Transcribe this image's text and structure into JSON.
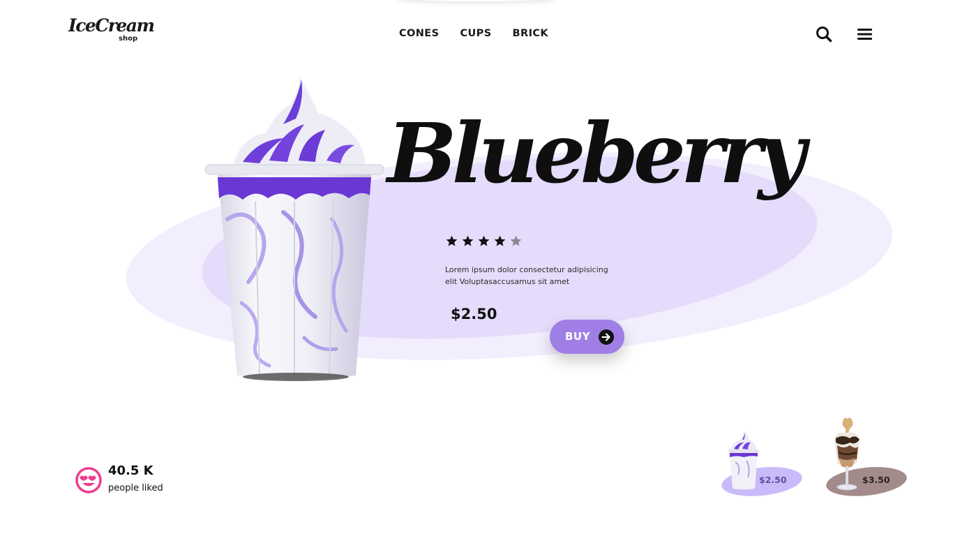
{
  "header": {
    "logo_main": "IceCream",
    "logo_sub": "shop",
    "nav": [
      {
        "label": "CONES"
      },
      {
        "label": "CUPS"
      },
      {
        "label": "BRICK"
      }
    ],
    "search_icon": "search-icon",
    "menu_icon": "hamburger-menu-icon"
  },
  "hero": {
    "title": "Blueberry",
    "rating": 4,
    "rating_max": 5,
    "description": "Lorem ipsum dolor consectetur adipisicing elit Voluptasaccusamus sit amet",
    "price": "$2.50",
    "buy_label": "BUY",
    "buy_icon": "arrow-right-circle-icon",
    "image": "blueberry-cup-image"
  },
  "likes": {
    "count": "40.5 K",
    "label": "people liked",
    "icon": "heart-eyes-emoji-icon"
  },
  "thumbnails": [
    {
      "price": "$2.50",
      "image": "blueberry-cup-thumbnail",
      "color": "#c9bbfa"
    },
    {
      "price": "$3.50",
      "image": "chocolate-sundae-thumbnail",
      "color": "#a38b8b"
    }
  ],
  "colors": {
    "accent": "#9f7fe6",
    "ellipse_light": "#f2eefe",
    "ellipse_mid": "#e5dcfc",
    "emoji_pink": "#ee3d8f",
    "text": "#111111"
  }
}
